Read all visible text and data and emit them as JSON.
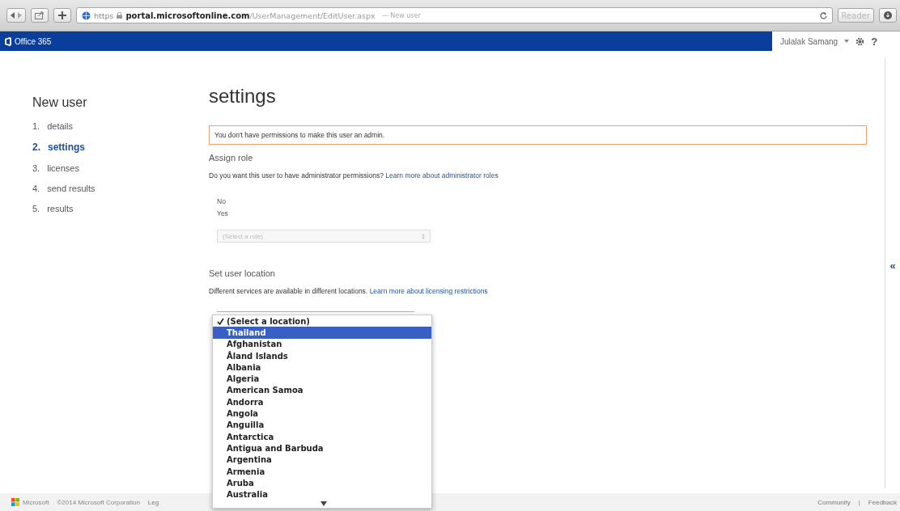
{
  "browser": {
    "url_scheme": "https",
    "url_host": "portal.microsoftonline.com",
    "url_path": "/UserManagement/EditUser.aspx",
    "page_title": "— New user",
    "reader_button": "Reader"
  },
  "header": {
    "app_name": "Office 365",
    "user_name": "Julalak Samang",
    "help": "?"
  },
  "nav": {
    "title": "New user",
    "steps": [
      {
        "number": "1.",
        "label": "details",
        "selected": false
      },
      {
        "number": "2.",
        "label": "settings",
        "selected": true
      },
      {
        "number": "3.",
        "label": "licenses",
        "selected": false
      },
      {
        "number": "4.",
        "label": "send results",
        "selected": false
      },
      {
        "number": "5.",
        "label": "results",
        "selected": false
      }
    ]
  },
  "content": {
    "title": "settings",
    "alert": "You don't have permissions to make this user an admin.",
    "role_section": {
      "heading": "Assign role",
      "text": "Do you want this user to have administrator permissions?",
      "link": "Learn more about administrator roles",
      "options": [
        "No",
        "Yes"
      ],
      "role_select": {
        "value": "(Select a role)",
        "disabled": true
      }
    },
    "location_section": {
      "heading": "Set user location",
      "text": "Different services are available in different locations.",
      "link": "Learn more about licensing restrictions"
    }
  },
  "location_dropdown": {
    "items": [
      {
        "label": "(Select a location)",
        "checked": true,
        "selected": false
      },
      {
        "label": "Thailand",
        "checked": false,
        "selected": true
      },
      {
        "label": "Afghanistan",
        "checked": false,
        "selected": false
      },
      {
        "label": "Åland Islands",
        "checked": false,
        "selected": false
      },
      {
        "label": "Albania",
        "checked": false,
        "selected": false
      },
      {
        "label": "Algeria",
        "checked": false,
        "selected": false
      },
      {
        "label": "American Samoa",
        "checked": false,
        "selected": false
      },
      {
        "label": "Andorra",
        "checked": false,
        "selected": false
      },
      {
        "label": "Angola",
        "checked": false,
        "selected": false
      },
      {
        "label": "Anguilla",
        "checked": false,
        "selected": false
      },
      {
        "label": "Antarctica",
        "checked": false,
        "selected": false
      },
      {
        "label": "Antigua and Barbuda",
        "checked": false,
        "selected": false
      },
      {
        "label": "Argentina",
        "checked": false,
        "selected": false
      },
      {
        "label": "Armenia",
        "checked": false,
        "selected": false
      },
      {
        "label": "Aruba",
        "checked": false,
        "selected": false
      },
      {
        "label": "Australia",
        "checked": false,
        "selected": false
      }
    ]
  },
  "side_panel": {
    "toggle": "«"
  },
  "footer": {
    "brand": "Microsoft",
    "copyright": "©2014 Microsoft Corporation",
    "legal": "Leg",
    "links": [
      "Community",
      "Feedback"
    ],
    "separator": "|"
  }
}
